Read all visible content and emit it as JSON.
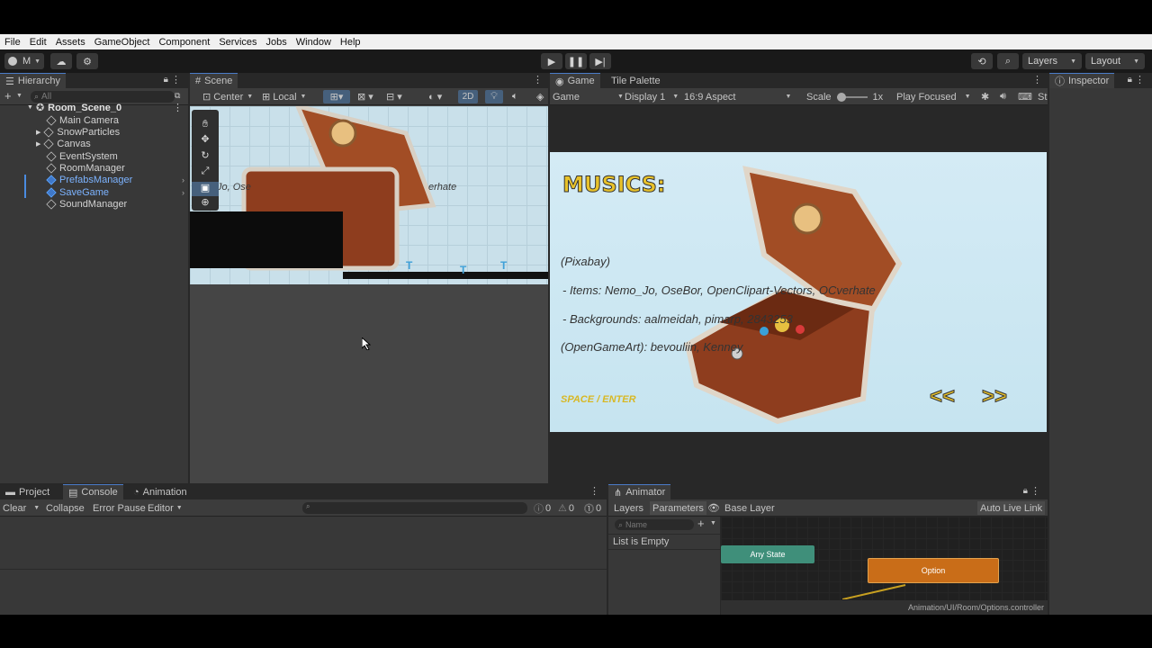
{
  "menu": [
    "File",
    "Edit",
    "Assets",
    "GameObject",
    "Component",
    "Services",
    "Jobs",
    "Window",
    "Help"
  ],
  "toolbar": {
    "account": "M",
    "layers": "Layers",
    "layout": "Layout"
  },
  "hierarchy": {
    "tab": "Hierarchy",
    "search_placeholder": "All",
    "scene": "Room_Scene_0",
    "items": [
      "Main Camera",
      "SnowParticles",
      "Canvas",
      "EventSystem",
      "RoomManager",
      "PrefabsManager",
      "SaveGame",
      "SoundManager"
    ]
  },
  "scene": {
    "tab": "Scene",
    "pivot": "Center",
    "space": "Local",
    "mode2d": "2D",
    "overlay_text": "Jo, Ose",
    "overlay_text2": "erhate"
  },
  "game": {
    "tabs": [
      "Game",
      "Tile Palette"
    ],
    "mode": "Game",
    "display": "Display 1",
    "aspect": "16:9 Aspect",
    "scale_label": "Scale",
    "scale": "1x",
    "play_mode": "Play Focused",
    "stats": "St",
    "title": "MUSICS:",
    "line1": "(Pixabay)",
    "line2": "- Items: Nemo_Jo, OseBor, OpenClipart-Vectors, OCverhate",
    "line3": "- Backgrounds: aalmeidah, pimarp, 2843253",
    "line4": "(OpenGameArt): bevouliin, Kenney",
    "hint": "SPACE / ENTER",
    "prev": "<<",
    "next": ">>"
  },
  "inspector": {
    "tab": "Inspector"
  },
  "bottom_left": {
    "tabs": [
      "Project",
      "Console",
      "Animation"
    ],
    "clear": "Clear",
    "collapse": "Collapse",
    "error_pause": "Error Pause",
    "editor": "Editor",
    "counts": [
      "0",
      "0",
      "0"
    ]
  },
  "animator": {
    "tab": "Animator",
    "layers_tab": "Layers",
    "params_tab": "Parameters",
    "layer": "Base Layer",
    "auto_live": "Auto Live Link",
    "name_placeholder": "Name",
    "empty": "List is Empty",
    "any_state": "Any State",
    "option": "Option",
    "path": "Animation/UI/Room/Options.controller"
  }
}
